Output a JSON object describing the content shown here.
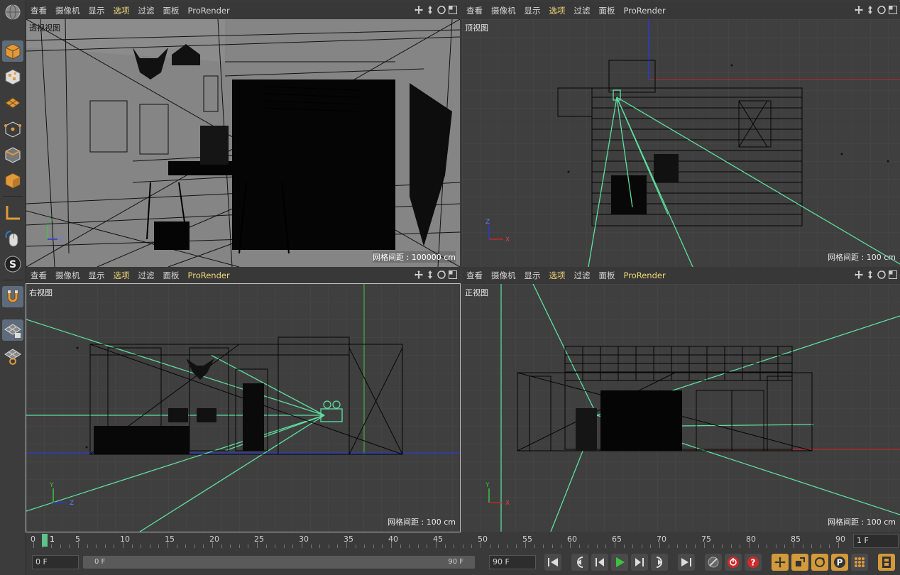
{
  "menu": [
    "查看",
    "摄像机",
    "显示",
    "选项",
    "过滤",
    "面板",
    "ProRender"
  ],
  "menu_selected_index": 3,
  "viewports": [
    {
      "id": "perspective",
      "label": "透视视图",
      "grid": "网格间距 : 100000 cm"
    },
    {
      "id": "top",
      "label": "顶视图",
      "grid": "网格间距 : 100 cm"
    },
    {
      "id": "right",
      "label": "右视图",
      "grid": "网格间距 : 100 cm"
    },
    {
      "id": "front",
      "label": "正视图",
      "grid": "网格间距 : 100 cm"
    }
  ],
  "axes": {
    "top": [
      "Z",
      "X"
    ],
    "right": [
      "Y",
      "Z"
    ],
    "front": [
      "Y",
      "X"
    ],
    "perspective": [
      "Y",
      "Z"
    ]
  },
  "timeline": {
    "ticks": [
      "0",
      "5",
      "10",
      "15",
      "20",
      "25",
      "30",
      "35",
      "40",
      "45",
      "50",
      "55",
      "60",
      "65",
      "70",
      "75",
      "80",
      "85",
      "90"
    ],
    "current_frame_marker": "1",
    "frame_box": "1 F"
  },
  "transport": {
    "start_field": "0 F",
    "slider_left": "0 F",
    "slider_right": "90 F",
    "end_field": "90 F"
  },
  "colors": {
    "camera_lines": "#5ee0a0",
    "axis_x": "#c02828",
    "axis_y": "#3ec23e",
    "axis_z": "#2a3ad0",
    "selected_menu": "#f0d67a"
  },
  "left_tools": [
    "make-editable-icon",
    "texture-mode-icon",
    "points-grid-icon",
    "edges-mode-icon",
    "polygons-mode-icon",
    "object-mode-icon",
    "axis-icon",
    "tweak-mouse-icon",
    "snap-s-icon",
    "magnet-icon",
    "workplane-lock-icon",
    "workplane-rotate-icon"
  ]
}
